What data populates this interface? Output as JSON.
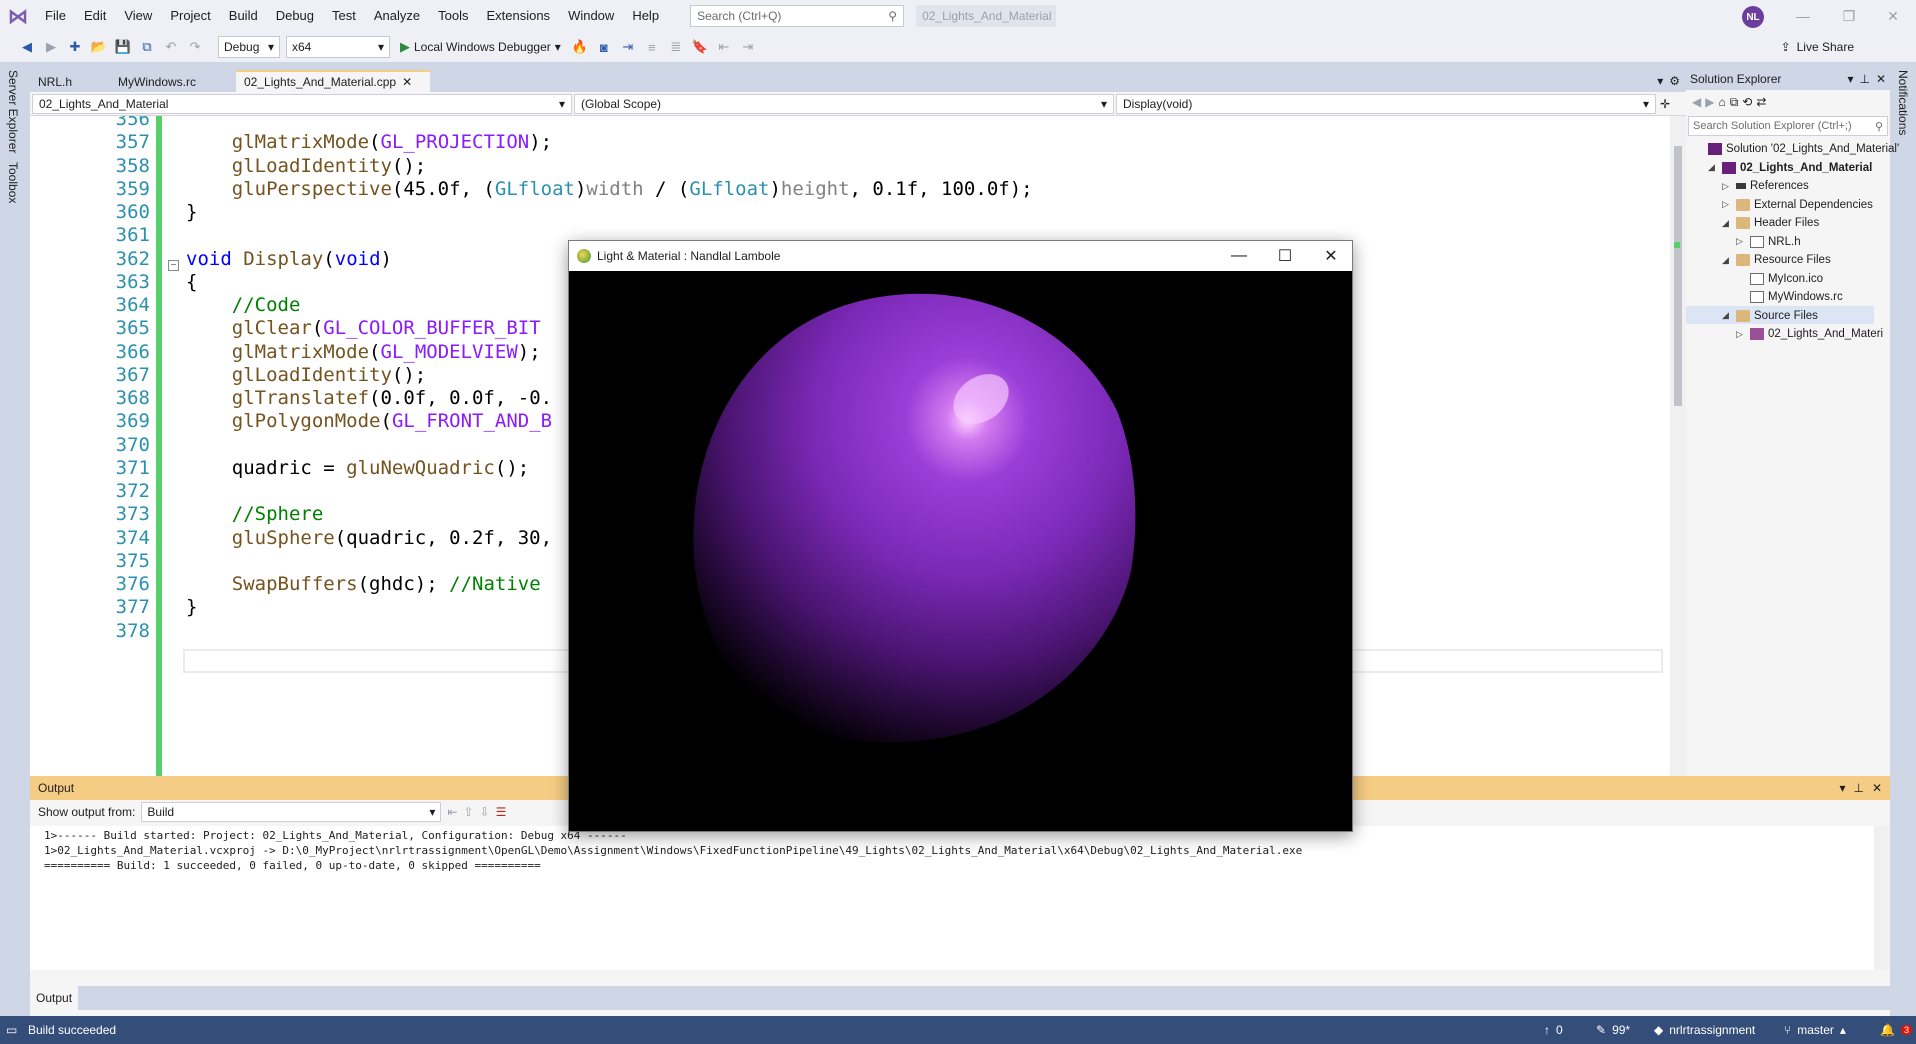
{
  "menubar": {
    "items": [
      "File",
      "Edit",
      "View",
      "Project",
      "Build",
      "Debug",
      "Test",
      "Analyze",
      "Tools",
      "Extensions",
      "Window",
      "Help"
    ],
    "search_placeholder": "Search (Ctrl+Q)",
    "solution_name": "02_Lights_And_Material",
    "avatar_initials": "NL"
  },
  "toolbar": {
    "config": "Debug",
    "platform": "x64",
    "debugger": "Local Windows Debugger",
    "live_share": "Live Share"
  },
  "side_tabs": {
    "left": [
      "Server Explorer",
      "Toolbox"
    ],
    "right": [
      "Notifications"
    ]
  },
  "editor": {
    "tabs": [
      "NRL.h",
      "MyWindows.rc",
      "02_Lights_And_Material.cpp"
    ],
    "nav": {
      "project": "02_Lights_And_Material",
      "scope": "(Global Scope)",
      "member": "Display(void)"
    },
    "lines": [
      {
        "n": "356",
        "segs": []
      },
      {
        "n": "357",
        "segs": [
          {
            "t": "    "
          },
          {
            "t": "glMatrixMode",
            "c": "fn"
          },
          {
            "t": "("
          },
          {
            "t": "GL_PROJECTION",
            "c": "mac"
          },
          {
            "t": ");"
          }
        ]
      },
      {
        "n": "358",
        "segs": [
          {
            "t": "    "
          },
          {
            "t": "glLoadIdentity",
            "c": "fn"
          },
          {
            "t": "();"
          }
        ]
      },
      {
        "n": "359",
        "segs": [
          {
            "t": "    "
          },
          {
            "t": "gluPerspective",
            "c": "fn"
          },
          {
            "t": "(45.0f, ("
          },
          {
            "t": "GLfloat",
            "c": "type"
          },
          {
            "t": ")"
          },
          {
            "t": "width",
            "c": "prm"
          },
          {
            "t": " / ("
          },
          {
            "t": "GLfloat",
            "c": "type"
          },
          {
            "t": ")"
          },
          {
            "t": "height",
            "c": "prm"
          },
          {
            "t": ", 0.1f, 100.0f);"
          }
        ]
      },
      {
        "n": "360",
        "segs": [
          {
            "t": "}"
          }
        ]
      },
      {
        "n": "361",
        "segs": []
      },
      {
        "n": "362",
        "segs": [
          {
            "t": "void",
            "c": "kw"
          },
          {
            "t": " "
          },
          {
            "t": "Display",
            "c": "fn"
          },
          {
            "t": "("
          },
          {
            "t": "void",
            "c": "kw"
          },
          {
            "t": ")"
          }
        ]
      },
      {
        "n": "363",
        "segs": [
          {
            "t": "{"
          }
        ]
      },
      {
        "n": "364",
        "segs": [
          {
            "t": "    "
          },
          {
            "t": "//Code",
            "c": "cm"
          }
        ]
      },
      {
        "n": "365",
        "segs": [
          {
            "t": "    "
          },
          {
            "t": "glClear",
            "c": "fn"
          },
          {
            "t": "("
          },
          {
            "t": "GL_COLOR_BUFFER_BIT",
            "c": "mac"
          }
        ]
      },
      {
        "n": "366",
        "segs": [
          {
            "t": "    "
          },
          {
            "t": "glMatrixMode",
            "c": "fn"
          },
          {
            "t": "("
          },
          {
            "t": "GL_MODELVIEW",
            "c": "mac"
          },
          {
            "t": ");"
          }
        ]
      },
      {
        "n": "367",
        "segs": [
          {
            "t": "    "
          },
          {
            "t": "glLoadIdentity",
            "c": "fn"
          },
          {
            "t": "();"
          }
        ]
      },
      {
        "n": "368",
        "segs": [
          {
            "t": "    "
          },
          {
            "t": "glTranslatef",
            "c": "fn"
          },
          {
            "t": "(0.0f, 0.0f, -0."
          }
        ]
      },
      {
        "n": "369",
        "segs": [
          {
            "t": "    "
          },
          {
            "t": "glPolygonMode",
            "c": "fn"
          },
          {
            "t": "("
          },
          {
            "t": "GL_FRONT_AND_B",
            "c": "mac"
          }
        ]
      },
      {
        "n": "370",
        "segs": []
      },
      {
        "n": "371",
        "segs": [
          {
            "t": "    "
          },
          {
            "t": "quadric = "
          },
          {
            "t": "gluNewQuadric",
            "c": "fn"
          },
          {
            "t": "();"
          }
        ]
      },
      {
        "n": "372",
        "segs": []
      },
      {
        "n": "373",
        "segs": [
          {
            "t": "    "
          },
          {
            "t": "//Sphere",
            "c": "cm"
          }
        ]
      },
      {
        "n": "374",
        "segs": [
          {
            "t": "    "
          },
          {
            "t": "gluSphere",
            "c": "fn"
          },
          {
            "t": "(quadric, 0.2f, 30,"
          }
        ]
      },
      {
        "n": "375",
        "segs": []
      },
      {
        "n": "376",
        "segs": [
          {
            "t": "    "
          },
          {
            "t": "SwapBuffers",
            "c": "fn"
          },
          {
            "t": "(ghdc); "
          },
          {
            "t": "//Native",
            "c": "cm"
          }
        ]
      },
      {
        "n": "377",
        "segs": [
          {
            "t": "}"
          }
        ]
      },
      {
        "n": "378",
        "segs": []
      }
    ]
  },
  "solution_explorer": {
    "title": "Solution Explorer",
    "search_placeholder": "Search Solution Explorer (Ctrl+;)",
    "items": [
      {
        "label": "Solution '02_Lights_And_Material'",
        "level": 0,
        "tri": "",
        "icon": "ico-proj",
        "bold": false
      },
      {
        "label": "02_Lights_And_Material",
        "level": 1,
        "tri": "◢",
        "icon": "ico-proj",
        "bold": true
      },
      {
        "label": "References",
        "level": 2,
        "tri": "▷",
        "icon": "ico-ref",
        "bold": false
      },
      {
        "label": "External Dependencies",
        "level": 2,
        "tri": "▷",
        "icon": "ico-folder",
        "bold": false
      },
      {
        "label": "Header Files",
        "level": 2,
        "tri": "◢",
        "icon": "ico-folder",
        "bold": false
      },
      {
        "label": "NRL.h",
        "level": 3,
        "tri": "▷",
        "icon": "ico-file",
        "bold": false
      },
      {
        "label": "Resource Files",
        "level": 2,
        "tri": "◢",
        "icon": "ico-folder",
        "bold": false
      },
      {
        "label": "MyIcon.ico",
        "level": 3,
        "tri": "",
        "icon": "ico-file",
        "bold": false
      },
      {
        "label": "MyWindows.rc",
        "level": 3,
        "tri": "",
        "icon": "ico-file",
        "bold": false
      },
      {
        "label": "Source Files",
        "level": 2,
        "tri": "◢",
        "icon": "ico-folder",
        "bold": false
      },
      {
        "label": "02_Lights_And_Materi",
        "level": 3,
        "tri": "▷",
        "icon": "ico-cpp",
        "bold": false
      }
    ]
  },
  "output": {
    "title": "Output",
    "show_from_label": "Show output from:",
    "source": "Build",
    "lines": [
      "1>------ Build started: Project: 02_Lights_And_Material, Configuration: Debug x64 ------",
      "1>02_Lights_And_Material.vcxproj -> D:\\0_MyProject\\nrlrtrassignment\\OpenGL\\Demo\\Assignment\\Windows\\FixedFunctionPipeline\\49_Lights\\02_Lights_And_Material\\x64\\Debug\\02_Lights_And_Material.exe",
      "========== Build: 1 succeeded, 0 failed, 0 up-to-date, 0 skipped =========="
    ],
    "tab_label": "Output"
  },
  "statusbar": {
    "message": "Build succeeded",
    "errors": "0",
    "edits": "99*",
    "repo": "nrlrtrassignment",
    "branch": "master",
    "notifications": "3"
  },
  "gl_window": {
    "title": "Light & Material : Nandlal Lambole"
  },
  "colors": {
    "accent": "#68217a",
    "statusbar": "#344d79",
    "output_header": "#f5cc84",
    "sphere": "#8a2fc8",
    "change_bar": "#57d06c"
  }
}
